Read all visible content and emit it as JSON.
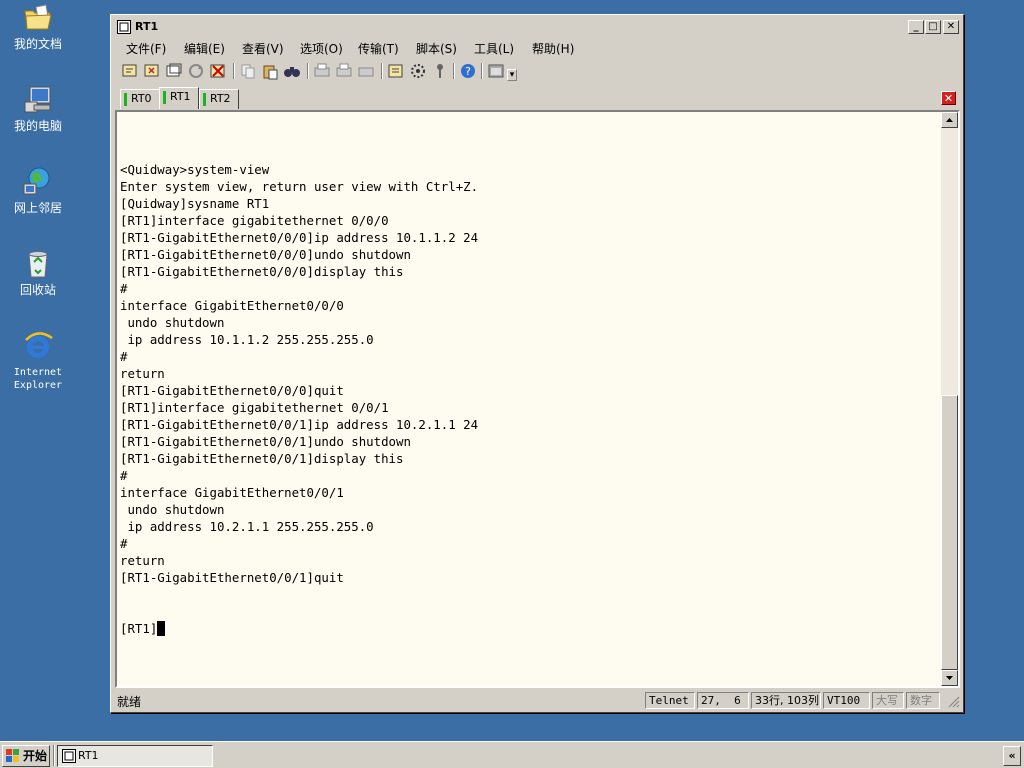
{
  "desktop": {
    "icons": [
      {
        "label": "我的文档",
        "icon": "folder-icon"
      },
      {
        "label": "我的电脑",
        "icon": "computer-icon"
      },
      {
        "label": "网上邻居",
        "icon": "network-icon"
      },
      {
        "label": "回收站",
        "icon": "recycle-bin-icon"
      },
      {
        "label_line1": "Internet",
        "label_line2": "Explorer",
        "icon": "ie-icon"
      }
    ]
  },
  "window": {
    "title": "RT1",
    "menus": [
      "文件(F)",
      "编辑(E)",
      "查看(V)",
      "选项(O)",
      "传输(T)",
      "脚本(S)",
      "工具(L)",
      "帮助(H)"
    ],
    "tabs": [
      {
        "label": "RT0",
        "active": false
      },
      {
        "label": "RT1",
        "active": true
      },
      {
        "label": "RT2",
        "active": false
      }
    ],
    "terminal_lines": [
      "<Quidway>system-view",
      "Enter system view, return user view with Ctrl+Z.",
      "[Quidway]sysname RT1",
      "[RT1]interface gigabitethernet 0/0/0",
      "[RT1-GigabitEthernet0/0/0]ip address 10.1.1.2 24",
      "[RT1-GigabitEthernet0/0/0]undo shutdown",
      "[RT1-GigabitEthernet0/0/0]display this",
      "#",
      "interface GigabitEthernet0/0/0",
      " undo shutdown",
      " ip address 10.1.1.2 255.255.255.0",
      "#",
      "return",
      "[RT1-GigabitEthernet0/0/0]quit",
      "[RT1]interface gigabitethernet 0/0/1",
      "[RT1-GigabitEthernet0/0/1]ip address 10.2.1.1 24",
      "[RT1-GigabitEthernet0/0/1]undo shutdown",
      "[RT1-GigabitEthernet0/0/1]display this",
      "#",
      "interface GigabitEthernet0/0/1",
      " undo shutdown",
      " ip address 10.2.1.1 255.255.255.0",
      "#",
      "return",
      "[RT1-GigabitEthernet0/0/1]quit"
    ],
    "prompt": "[RT1]",
    "status": {
      "ready": "就绪",
      "protocol": "Telnet",
      "cursor_pos": "27,  6",
      "dimensions": "33行, 103列",
      "emulation": "VT100",
      "caps": "大写",
      "num": "数字"
    }
  },
  "taskbar": {
    "start_label": "开始",
    "task_label": "RT1",
    "tray_button": "«"
  },
  "colors": {
    "desktop": "#3a6ea5",
    "terminal_bg": "#fefcf0",
    "chrome": "#d4d0c8",
    "tab_indicator": "#1db31d",
    "close_red": "#d52020"
  }
}
